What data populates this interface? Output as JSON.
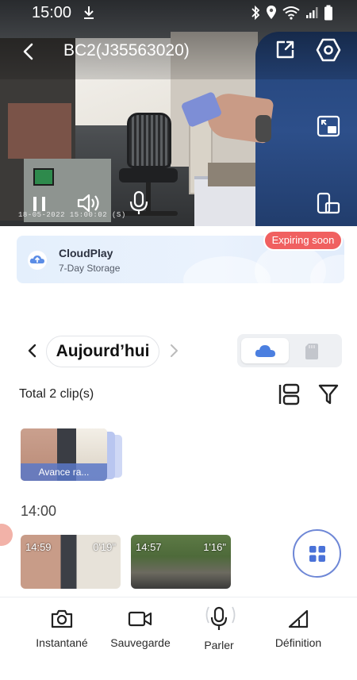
{
  "status_bar": {
    "time": "15:00"
  },
  "header": {
    "title": "BC2(J35563020)"
  },
  "video": {
    "timestamp": "18-05-2022 15:00:02 (S)"
  },
  "cloud_card": {
    "service_name": "CloudPlay",
    "plan": "7-Day Storage",
    "badge": "Expiring soon"
  },
  "date_nav": {
    "label": "Aujourd’hui"
  },
  "clips_summary": {
    "total": "Total 2 clip(s)"
  },
  "highlight_clip": {
    "label": "Avance ra..."
  },
  "timeline": {
    "hour": "14:00",
    "clips": [
      {
        "time": "14:59",
        "duration": "0'19\""
      },
      {
        "time": "14:57",
        "duration": "1'16\""
      }
    ]
  },
  "toolbar": {
    "items": [
      {
        "label": "Instantané",
        "icon": "camera-icon"
      },
      {
        "label": "Sauvegarde",
        "icon": "video-record-icon"
      },
      {
        "label": "Parler",
        "icon": "microphone-icon"
      },
      {
        "label": "Définition",
        "icon": "definition-icon"
      }
    ]
  },
  "colors": {
    "accent": "#3f6fd8",
    "badge": "#f06060",
    "card_bg": "#e6effc"
  }
}
